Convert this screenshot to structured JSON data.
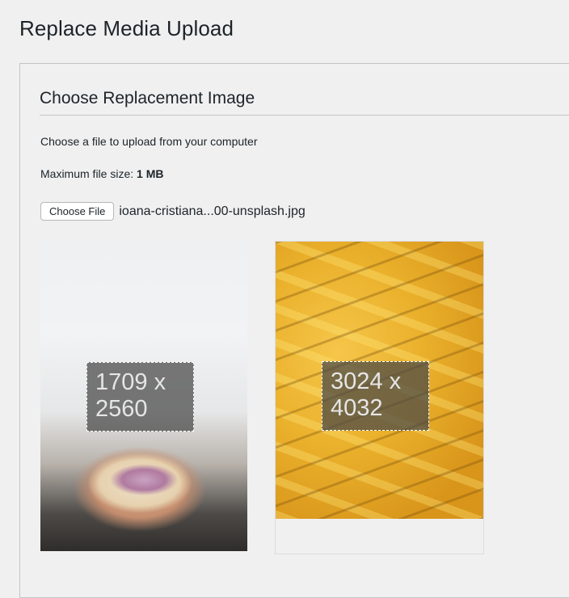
{
  "page": {
    "title": "Replace Media Upload"
  },
  "section": {
    "title": "Choose Replacement Image",
    "description": "Choose a file to upload from your computer",
    "max_size_label": "Maximum file size: ",
    "max_size_value": "1 MB"
  },
  "file_input": {
    "button_label": "Choose File",
    "selected_file": "ioana-cristiana...00-unsplash.jpg"
  },
  "images": {
    "current": {
      "width_text": "1709 x",
      "height_text": "2560"
    },
    "replacement": {
      "width_text": "3024 x",
      "height_text": "4032"
    }
  }
}
